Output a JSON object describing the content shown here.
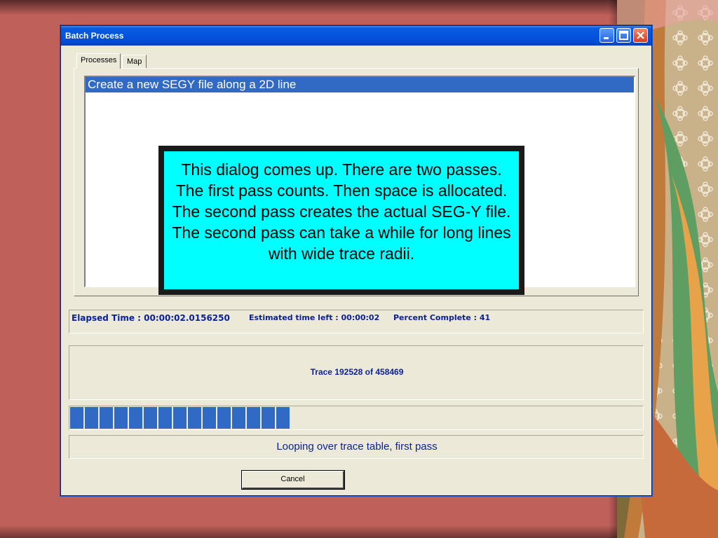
{
  "window": {
    "title": "Batch Process"
  },
  "tabs": [
    {
      "label": "Processes"
    },
    {
      "label": "Map"
    }
  ],
  "process_list": {
    "items": [
      {
        "label": "Create a new SEGY file along a 2D line",
        "selected": true
      }
    ]
  },
  "status": {
    "elapsed": "Elapsed Time : 00:00:02.0156250",
    "estimated": "Estimated time left : 00:00:02",
    "percent": "Percent Complete : 41"
  },
  "trace": {
    "text": "Trace 192528 of 458469"
  },
  "progress": {
    "fraction": 0.41
  },
  "loop": {
    "text": "Looping over trace table, first pass"
  },
  "buttons": {
    "cancel": "Cancel"
  },
  "callout": {
    "text": "This dialog comes up.  There are two passes.  The first pass counts.  Then space is allocated.  The second pass creates the actual SEG-Y file.  The second pass can take a while for long lines with wide trace radii."
  },
  "colors": {
    "titlebar": "#0454e0",
    "selection": "#316ac5",
    "status_text": "#0a1f9a",
    "callout_bg": "#00ffff",
    "slide_bg": "#c0605a"
  }
}
